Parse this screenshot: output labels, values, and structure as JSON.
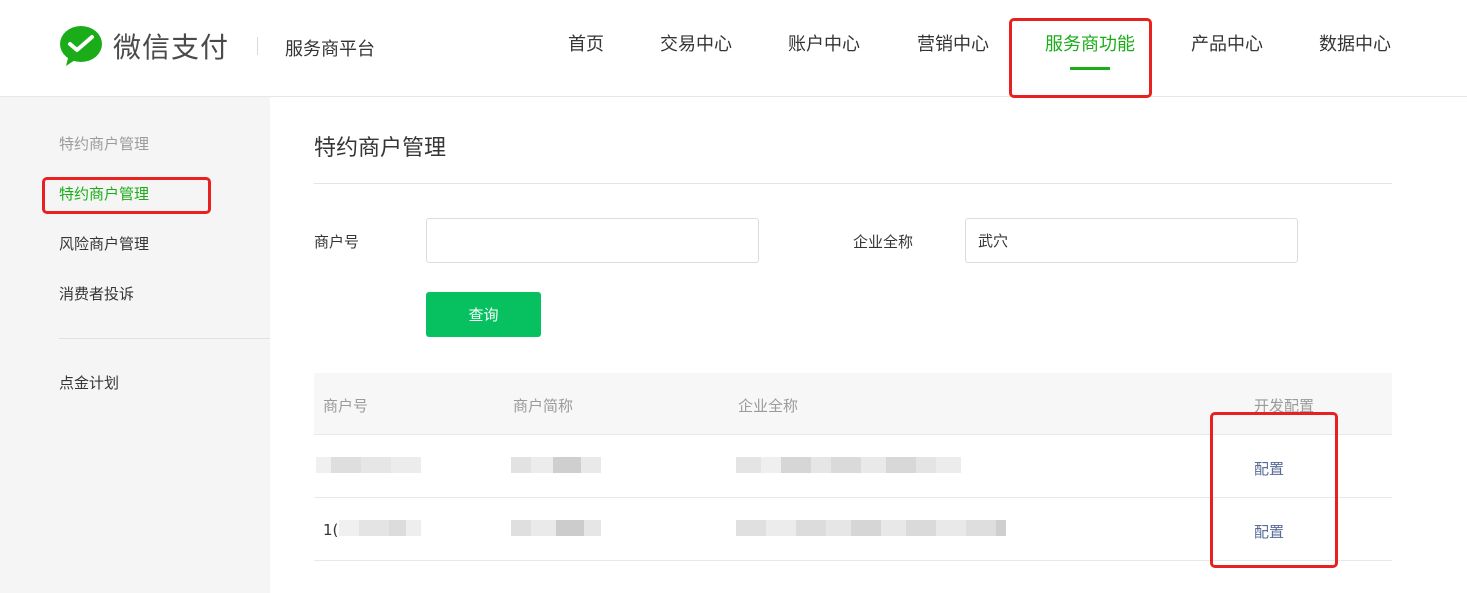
{
  "header": {
    "brand": "微信支付",
    "platform": "服务商平台",
    "nav": [
      {
        "label": "首页"
      },
      {
        "label": "交易中心"
      },
      {
        "label": "账户中心"
      },
      {
        "label": "营销中心"
      },
      {
        "label": "服务商功能",
        "active": true
      },
      {
        "label": "产品中心"
      },
      {
        "label": "数据中心"
      }
    ]
  },
  "sidebar": {
    "group_title": "特约商户管理",
    "items": [
      {
        "label": "特约商户管理",
        "active": true
      },
      {
        "label": "风险商户管理"
      },
      {
        "label": "消费者投诉"
      },
      {
        "label": "点金计划"
      }
    ]
  },
  "main": {
    "title": "特约商户管理",
    "form": {
      "merchant_id_label": "商户号",
      "merchant_id_value": "",
      "company_label": "企业全称",
      "company_value": "武穴",
      "query_button": "查询"
    },
    "table": {
      "headers": [
        "商户号",
        "商户简称",
        "企业全称",
        "开发配置"
      ],
      "rows": [
        {
          "merchant_id_prefix": "",
          "action": "配置"
        },
        {
          "merchant_id_prefix": "1(",
          "action": "配置"
        }
      ]
    }
  },
  "colors": {
    "brand_green": "#1aad19",
    "button_green": "#07c160",
    "link_blue": "#576b95",
    "annotation_red": "#e8201f",
    "sidebar_bg": "#f5f5f5"
  },
  "icons": {
    "logo": "wechat-pay-check-bubble-icon"
  }
}
